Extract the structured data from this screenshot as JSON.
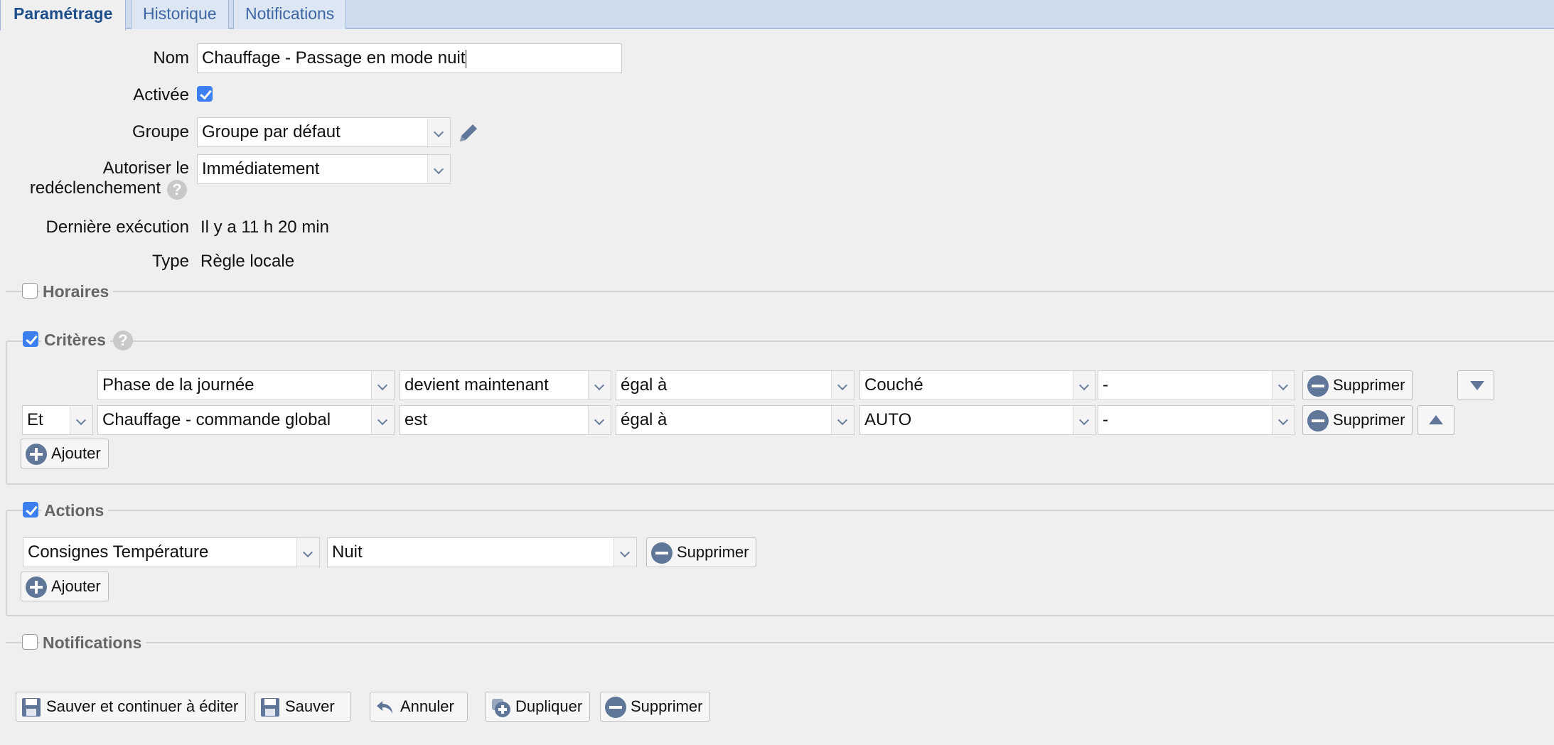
{
  "tabs": [
    {
      "label": "Paramétrage",
      "active": true
    },
    {
      "label": "Historique",
      "active": false
    },
    {
      "label": "Notifications",
      "active": false
    }
  ],
  "form": {
    "name_label": "Nom",
    "name_value": "Chauffage - Passage en mode nuit",
    "enabled_label": "Activée",
    "enabled": true,
    "group_label": "Groupe",
    "group_value": "Groupe par défaut",
    "retrigger_label_line1": "Autoriser le",
    "retrigger_label_line2": "redéclenchement",
    "retrigger_value": "Immédiatement",
    "last_exec_label": "Dernière exécution",
    "last_exec_value": "Il y a 11 h 20 min",
    "type_label": "Type",
    "type_value": "Règle locale"
  },
  "sections": {
    "horaires": {
      "label": "Horaires",
      "checked": false
    },
    "criteres": {
      "label": "Critères",
      "checked": true
    },
    "actions": {
      "label": "Actions",
      "checked": true
    },
    "notifications": {
      "label": "Notifications",
      "checked": false
    }
  },
  "criteria": [
    {
      "connector": "",
      "field": "Phase de la journée",
      "event": "devient maintenant",
      "operator": "égal à",
      "value": "Couché",
      "extra": "-",
      "delete_label": "Supprimer"
    },
    {
      "connector": "Et",
      "field": "Chauffage - commande global",
      "event": "est",
      "operator": "égal à",
      "value": "AUTO",
      "extra": "-",
      "delete_label": "Supprimer"
    }
  ],
  "criteria_add_label": "Ajouter",
  "actions": [
    {
      "target": "Consignes Température",
      "value": "Nuit",
      "delete_label": "Supprimer"
    }
  ],
  "actions_add_label": "Ajouter",
  "footer_buttons": {
    "save_continue": "Sauver et continuer à éditer",
    "save": "Sauver",
    "cancel": "Annuler",
    "duplicate": "Dupliquer",
    "delete": "Supprimer"
  },
  "help_glyph": "?",
  "colors": {
    "accent": "#3b7ff0",
    "tab_bar": "#cfdcee",
    "icon": "#61779a"
  }
}
